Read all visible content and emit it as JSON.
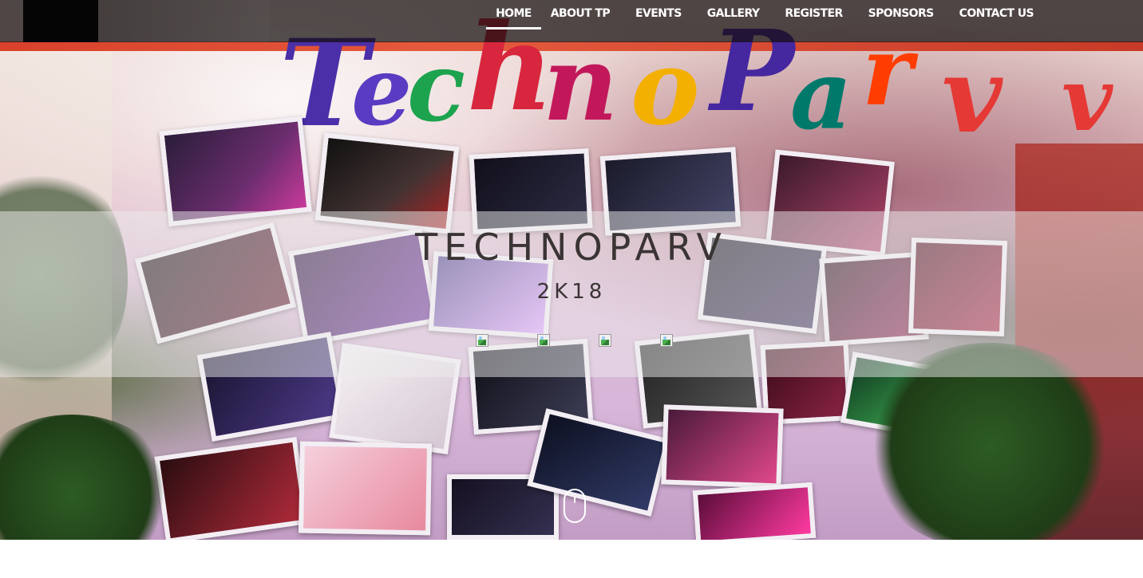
{
  "nav": {
    "items": [
      {
        "label": "HOME",
        "active": true
      },
      {
        "label": "ABOUT TP",
        "active": false
      },
      {
        "label": "EVENTS",
        "active": false
      },
      {
        "label": "GALLERY",
        "active": false
      },
      {
        "label": "REGISTER",
        "active": false
      },
      {
        "label": "SPONSORS",
        "active": false
      },
      {
        "label": "CONTACT US",
        "active": false
      }
    ]
  },
  "hero": {
    "title": "TECHNOPARV",
    "subtitle": "2K18",
    "social_icons": [
      "broken-image-icon",
      "broken-image-icon",
      "broken-image-icon",
      "broken-image-icon"
    ],
    "scroll_icon": "mouse-scroll-icon"
  },
  "colors": {
    "nav_bg": "#140e0e",
    "banner_bg": "#ebebeb",
    "title_text": "#3a3434"
  }
}
